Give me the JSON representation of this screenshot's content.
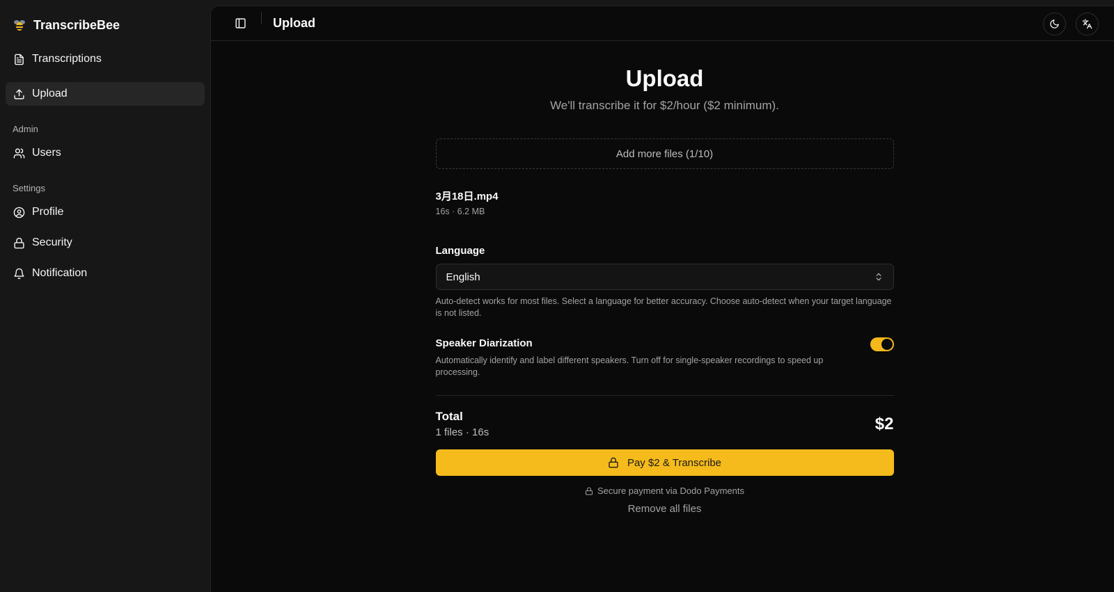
{
  "brand": {
    "name": "TranscribeBee"
  },
  "sidebar": {
    "items": [
      {
        "label": "Transcriptions",
        "icon": "file-text-icon"
      },
      {
        "label": "Upload",
        "icon": "upload-icon",
        "active": true
      }
    ],
    "admin_label": "Admin",
    "admin_items": [
      {
        "label": "Users",
        "icon": "users-icon"
      }
    ],
    "settings_label": "Settings",
    "settings_items": [
      {
        "label": "Profile",
        "icon": "user-circle-icon"
      },
      {
        "label": "Security",
        "icon": "lock-icon"
      },
      {
        "label": "Notification",
        "icon": "bell-icon"
      }
    ]
  },
  "header": {
    "title": "Upload"
  },
  "main": {
    "heading": "Upload",
    "subheading": "We'll transcribe it for $2/hour ($2 minimum).",
    "dropzone_label": "Add more files (1/10)",
    "file": {
      "name": "3月18日.mp4",
      "meta": "16s · 6.2 MB"
    },
    "language": {
      "label": "Language",
      "value": "English",
      "help": "Auto-detect works for most files. Select a language for better accuracy. Choose auto-detect when your target language is not listed."
    },
    "diarization": {
      "label": "Speaker Diarization",
      "help": "Automatically identify and label different speakers. Turn off for single-speaker recordings to speed up processing.",
      "enabled": true
    },
    "total": {
      "label": "Total",
      "sub": "1 files · 16s",
      "amount": "$2"
    },
    "pay_button": "Pay $2 & Transcribe",
    "secure_text": "Secure payment via Dodo Payments",
    "remove_all": "Remove all files"
  },
  "colors": {
    "accent": "#f5bb1c",
    "background": "#0a0a0a",
    "sidebar": "#171717"
  }
}
